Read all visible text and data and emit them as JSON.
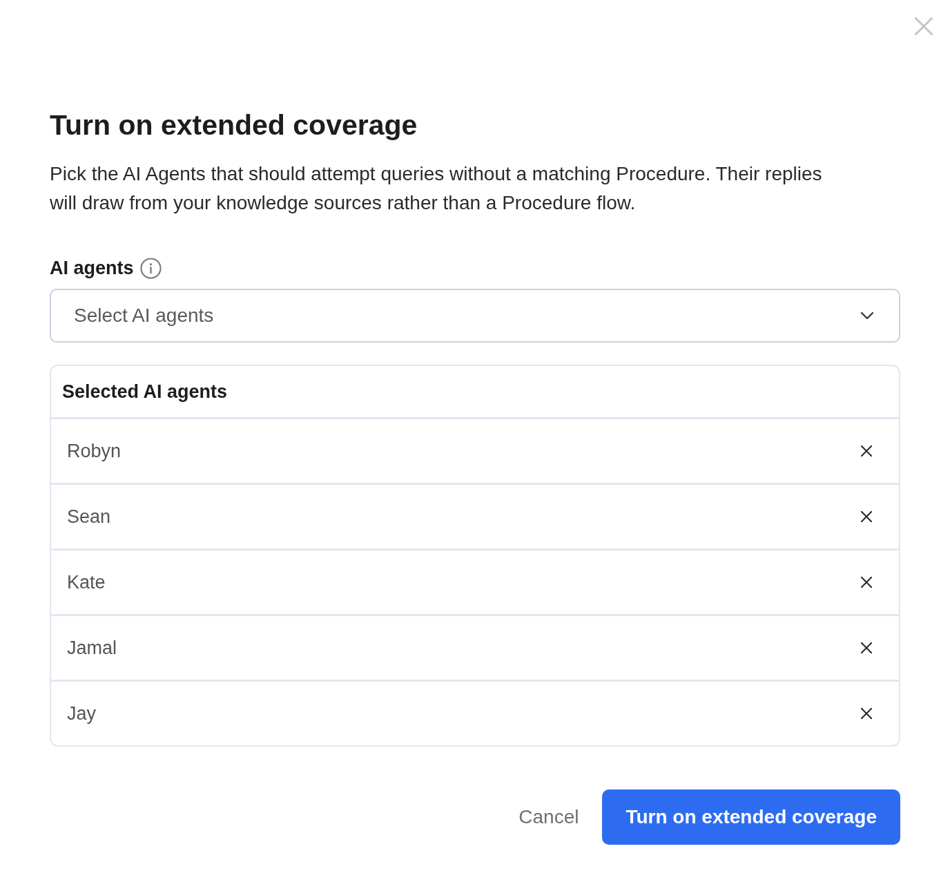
{
  "dialog": {
    "title": "Turn on extended coverage",
    "description": "Pick the AI Agents that should attempt queries without a matching Procedure. Their replies will draw from your knowledge sources rather than a Procedure flow."
  },
  "field": {
    "label": "AI agents",
    "placeholder": "Select AI agents"
  },
  "selected_panel": {
    "title": "Selected AI agents",
    "items": [
      {
        "name": "Robyn"
      },
      {
        "name": "Sean"
      },
      {
        "name": "Kate"
      },
      {
        "name": "Jamal"
      },
      {
        "name": "Jay"
      }
    ]
  },
  "buttons": [
    {
      "label": "Cancel",
      "kind": "text"
    },
    {
      "label": "Turn on extended coverage",
      "kind": "primary"
    }
  ]
}
